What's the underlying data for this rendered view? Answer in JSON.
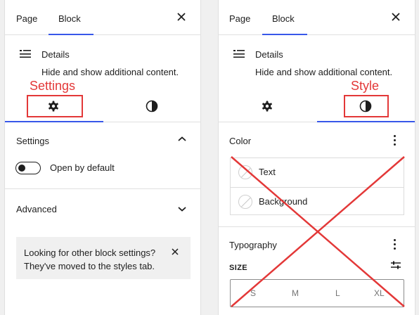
{
  "left_panel": {
    "tabs": [
      "Page",
      "Block"
    ],
    "active_tab": "Block",
    "block": {
      "title": "Details",
      "description": "Hide and show additional content."
    },
    "annotation": "Settings",
    "settings_section": {
      "title": "Settings",
      "toggle_label": "Open by default",
      "toggle_on": false
    },
    "advanced_section": {
      "title": "Advanced"
    },
    "notice": {
      "line1": "Looking for other block settings?",
      "line2": "They've moved to the styles tab."
    }
  },
  "right_panel": {
    "tabs": [
      "Page",
      "Block"
    ],
    "active_tab": "Block",
    "block": {
      "title": "Details",
      "description": "Hide and show additional content."
    },
    "annotation": "Style",
    "color_section": {
      "title": "Color",
      "items": [
        "Text",
        "Background"
      ]
    },
    "typography_section": {
      "title": "Typography",
      "size_label": "SIZE",
      "sizes": [
        "S",
        "M",
        "L",
        "XL"
      ]
    }
  },
  "colors": {
    "accent": "#3858e9",
    "annotation": "#e33838"
  }
}
